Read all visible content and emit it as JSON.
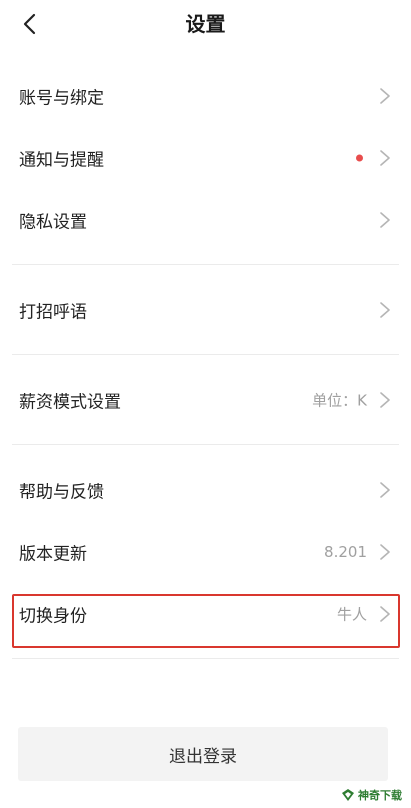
{
  "header": {
    "title": "设置",
    "back_icon": "chevron-left-icon"
  },
  "section1": [
    {
      "label": "账号与绑定",
      "value": "",
      "has_dot": false
    },
    {
      "label": "通知与提醒",
      "value": "",
      "has_dot": true
    },
    {
      "label": "隐私设置",
      "value": "",
      "has_dot": false
    }
  ],
  "section2": [
    {
      "label": "打招呼语",
      "value": ""
    }
  ],
  "section3": [
    {
      "label": "薪资模式设置",
      "value": "单位：K"
    }
  ],
  "section4": [
    {
      "label": "帮助与反馈",
      "value": ""
    },
    {
      "label": "版本更新",
      "value": "8.201"
    },
    {
      "label": "切换身份",
      "value": "牛人"
    }
  ],
  "logout": {
    "label": "退出登录"
  },
  "watermark": {
    "text": "神奇下载"
  },
  "colors": {
    "notification_dot": "#e84d4d",
    "highlight_border": "#d9372e",
    "chevron": "#b5b5b5",
    "watermark": "#2e7d32"
  }
}
